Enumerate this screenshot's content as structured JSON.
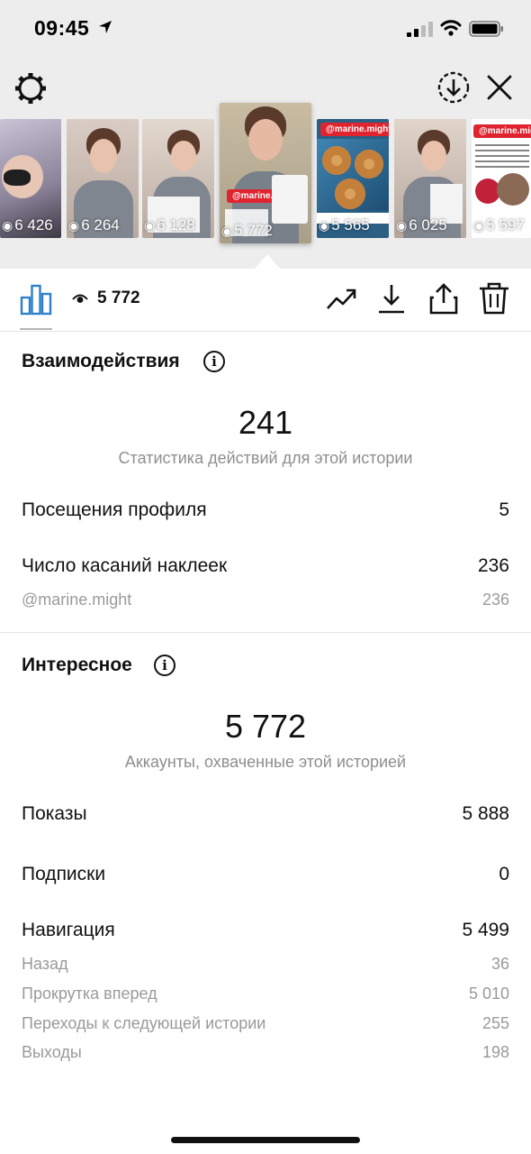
{
  "status_bar": {
    "time": "09:45"
  },
  "thumbnails": [
    {
      "views": "6 426",
      "tag": ""
    },
    {
      "views": "6 264",
      "tag": ""
    },
    {
      "views": "6 128",
      "tag": ""
    },
    {
      "views": "5 772",
      "tag": "@marine.might",
      "selected": true
    },
    {
      "views": "5 565",
      "tag": "@marine.might"
    },
    {
      "views": "6 025",
      "tag": ""
    },
    {
      "views": "5 597",
      "tag": "@marine.might"
    }
  ],
  "tabbar": {
    "reach_count": "5 772"
  },
  "interactions": {
    "title": "Взаимодействия",
    "total": "241",
    "total_caption": "Статистика действий для этой истории",
    "rows": [
      {
        "label": "Посещения профиля",
        "value": "5"
      },
      {
        "label": "Число касаний наклеек",
        "value": "236"
      }
    ],
    "sub_rows": [
      {
        "label": "@marine.might",
        "value": "236"
      }
    ]
  },
  "discovery": {
    "title": "Интересное",
    "total": "5 772",
    "total_caption": "Аккаунты, охваченные этой историей",
    "rows": [
      {
        "label": "Показы",
        "value": "5 888"
      },
      {
        "label": "Подписки",
        "value": "0"
      },
      {
        "label": "Навигация",
        "value": "5 499"
      }
    ],
    "navigation_rows": [
      {
        "label": "Назад",
        "value": "36"
      },
      {
        "label": "Прокрутка вперед",
        "value": "5 010"
      },
      {
        "label": "Переходы к следующей истории",
        "value": "255"
      },
      {
        "label": "Выходы",
        "value": "198"
      }
    ]
  },
  "colors": {
    "accent": "#2f80c8",
    "tag_red": "#e0242f",
    "muted": "#8e8e8e"
  }
}
